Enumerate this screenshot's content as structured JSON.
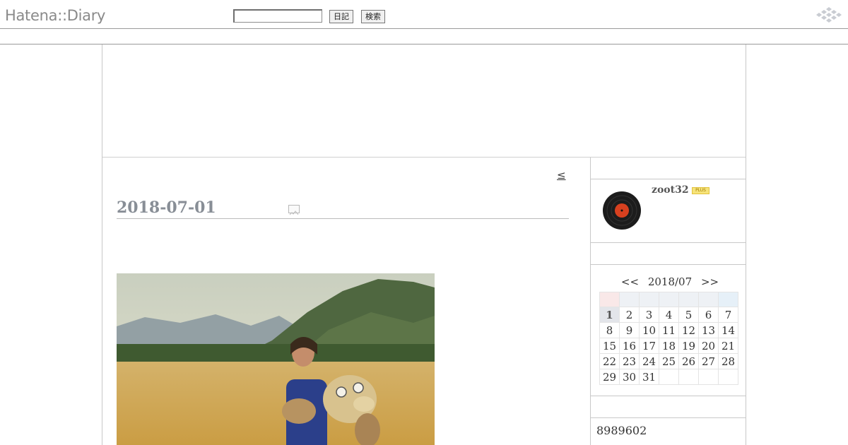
{
  "header": {
    "logo": "Hatena::Diary",
    "search_value": "",
    "diary_button": "日記",
    "search_button": "検索",
    "hatena_mark_icon": "hatena-diamond-icon"
  },
  "entry": {
    "prev_link": "≤",
    "date": "2018-07-01",
    "date_icon": "image-icon"
  },
  "profile": {
    "username": "zoot32",
    "badge": "PLUS",
    "avatar_icon": "vinyl-record-icon"
  },
  "calendar": {
    "prev": "<<",
    "month": "2018/07",
    "next": ">>",
    "weeks": [
      [
        "1",
        "2",
        "3",
        "4",
        "5",
        "6",
        "7"
      ],
      [
        "8",
        "9",
        "10",
        "11",
        "12",
        "13",
        "14"
      ],
      [
        "15",
        "16",
        "17",
        "18",
        "19",
        "20",
        "21"
      ],
      [
        "22",
        "23",
        "24",
        "25",
        "26",
        "27",
        "28"
      ],
      [
        "29",
        "30",
        "31",
        "",
        "",
        "",
        ""
      ]
    ]
  },
  "counter": "8989602",
  "colors": {
    "date_title": "#888e96",
    "border": "#c8c8c8"
  }
}
